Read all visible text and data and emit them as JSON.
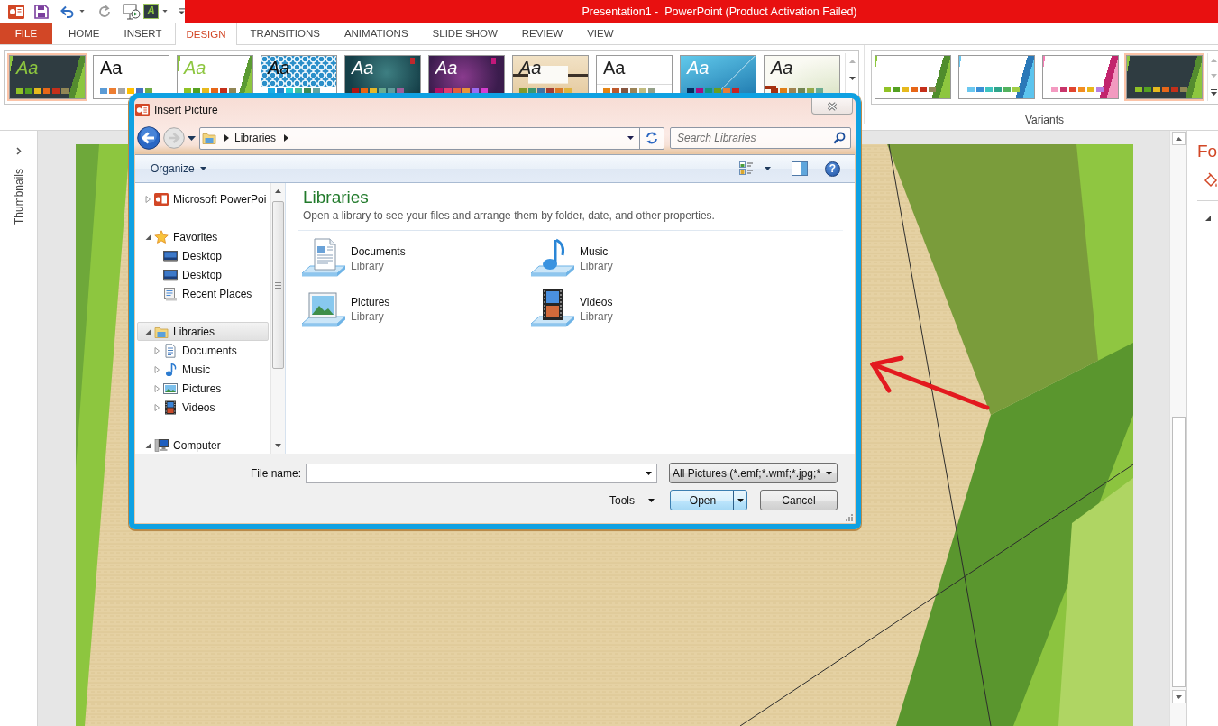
{
  "quick_access": {
    "theme_letter": "A"
  },
  "window": {
    "title": "Presentation1 -  PowerPoint (Product Activation Failed)"
  },
  "tabs": [
    {
      "label": "FILE",
      "kind": "file",
      "selected": false
    },
    {
      "label": "HOME",
      "kind": "tab",
      "selected": false
    },
    {
      "label": "INSERT",
      "kind": "tab",
      "selected": false
    },
    {
      "label": "DESIGN",
      "kind": "tab",
      "selected": true
    },
    {
      "label": "TRANSITIONS",
      "kind": "tab",
      "selected": false
    },
    {
      "label": "ANIMATIONS",
      "kind": "tab",
      "selected": false
    },
    {
      "label": "SLIDE SHOW",
      "kind": "tab",
      "selected": false
    },
    {
      "label": "REVIEW",
      "kind": "tab",
      "selected": false
    },
    {
      "label": "VIEW",
      "kind": "tab",
      "selected": false
    }
  ],
  "themes": [
    {
      "kind": "facet-dark",
      "sample": "Aa",
      "selected": true,
      "swatches": [
        {
          "color": "#90c226"
        },
        {
          "color": "#54a021"
        },
        {
          "color": "#e6b91e"
        },
        {
          "color": "#e76618"
        },
        {
          "color": "#c42f1a"
        },
        {
          "color": "#918655"
        }
      ]
    },
    {
      "kind": "office",
      "sample": "Aa",
      "selected": false,
      "swatches": [
        {
          "color": "#5b9bd5"
        },
        {
          "color": "#ed7d31"
        },
        {
          "color": "#a5a5a5"
        },
        {
          "color": "#ffc000"
        },
        {
          "color": "#4472c4"
        },
        {
          "color": "#70ad47"
        }
      ]
    },
    {
      "kind": "facet",
      "sample": "Aa",
      "selected": false,
      "swatches": [
        {
          "color": "#90c226"
        },
        {
          "color": "#54a021"
        },
        {
          "color": "#e6b91e"
        },
        {
          "color": "#e76618"
        },
        {
          "color": "#c42f1a"
        },
        {
          "color": "#918655"
        }
      ]
    },
    {
      "kind": "pattern",
      "sample": "Aa",
      "selected": false,
      "swatches": [
        {
          "color": "#1cade4"
        },
        {
          "color": "#2683c6"
        },
        {
          "color": "#27ced7"
        },
        {
          "color": "#42ba97"
        },
        {
          "color": "#3e8853"
        },
        {
          "color": "#62a39f"
        }
      ]
    },
    {
      "kind": "ion",
      "sample": "Aa",
      "selected": false,
      "swatches": [
        {
          "color": "#b01513"
        },
        {
          "color": "#ea6312"
        },
        {
          "color": "#e6b729"
        },
        {
          "color": "#6aac90"
        },
        {
          "color": "#5f9c9d"
        },
        {
          "color": "#9e5e9b"
        }
      ]
    },
    {
      "kind": "ion-boardroom",
      "sample": "Aa",
      "selected": false,
      "swatches": [
        {
          "color": "#b31166"
        },
        {
          "color": "#e33d6f"
        },
        {
          "color": "#e45f3c"
        },
        {
          "color": "#e9943a"
        },
        {
          "color": "#9b6bf2"
        },
        {
          "color": "#d53dd0"
        }
      ]
    },
    {
      "kind": "organic",
      "sample": "Aa",
      "selected": false,
      "swatches": [
        {
          "color": "#83992a"
        },
        {
          "color": "#3c9770"
        },
        {
          "color": "#44709d"
        },
        {
          "color": "#a23c33"
        },
        {
          "color": "#d97828"
        },
        {
          "color": "#deb340"
        }
      ]
    },
    {
      "kind": "retrospect",
      "sample": "Aa",
      "selected": false,
      "swatches": [
        {
          "color": "#e48312"
        },
        {
          "color": "#bd582c"
        },
        {
          "color": "#865640"
        },
        {
          "color": "#9b8357"
        },
        {
          "color": "#c2bc80"
        },
        {
          "color": "#94a088"
        }
      ]
    },
    {
      "kind": "slice",
      "sample": "Aa",
      "selected": false,
      "swatches": [
        {
          "color": "#052f61"
        },
        {
          "color": "#a50e82"
        },
        {
          "color": "#14967c"
        },
        {
          "color": "#6a9e1f"
        },
        {
          "color": "#e87d37"
        },
        {
          "color": "#c62324"
        }
      ]
    },
    {
      "kind": "wisp",
      "sample": "Aa",
      "selected": false,
      "swatches": [
        {
          "color": "#a53010"
        },
        {
          "color": "#de7e18"
        },
        {
          "color": "#9f8351"
        },
        {
          "color": "#728653"
        },
        {
          "color": "#92aa4c"
        },
        {
          "color": "#6aac91"
        }
      ]
    }
  ],
  "variants": {
    "label": "Variants",
    "items": [
      {
        "kind": "variant-green",
        "selected": false,
        "swatches": [
          {
            "color": "#90c226"
          },
          {
            "color": "#54a021"
          },
          {
            "color": "#e6b91e"
          },
          {
            "color": "#e76618"
          },
          {
            "color": "#c42f1a"
          },
          {
            "color": "#918655"
          }
        ]
      },
      {
        "kind": "variant-blue",
        "selected": false,
        "swatches": [
          {
            "color": "#6ac7f0"
          },
          {
            "color": "#3a8fd6"
          },
          {
            "color": "#3ec4c0"
          },
          {
            "color": "#2fa58b"
          },
          {
            "color": "#52b25d"
          },
          {
            "color": "#9fcd45"
          }
        ]
      },
      {
        "kind": "variant-pink",
        "selected": false,
        "swatches": [
          {
            "color": "#f49ac1"
          },
          {
            "color": "#c8356a"
          },
          {
            "color": "#e1452f"
          },
          {
            "color": "#f28e21"
          },
          {
            "color": "#e8b71a"
          },
          {
            "color": "#b77fe0"
          }
        ]
      },
      {
        "kind": "variant-dark",
        "selected": true,
        "swatches": [
          {
            "color": "#90c226"
          },
          {
            "color": "#54a021"
          },
          {
            "color": "#e6b91e"
          },
          {
            "color": "#e76618"
          },
          {
            "color": "#c42f1a"
          },
          {
            "color": "#918655"
          }
        ]
      }
    ]
  },
  "thumbnails_pane": {
    "label": "Thumbnails"
  },
  "format_pane": {
    "title": "Fo"
  },
  "dialog": {
    "title": "Insert Picture",
    "address": {
      "back": {
        "disabled": false
      },
      "forward": {
        "disabled": true
      },
      "crumbs": [
        "Libraries"
      ]
    },
    "search": {
      "placeholder": "Search Libraries"
    },
    "toolbar": {
      "organize": "Organize",
      "help": "?"
    },
    "nav": [
      {
        "label": "Microsoft PowerPoi",
        "kind": "app",
        "expanded": false,
        "selected": false
      },
      {
        "label": "Favorites",
        "kind": "favorites",
        "expanded": true,
        "selected": false,
        "children": [
          {
            "label": "Desktop",
            "kind": "desktop",
            "selected": false
          },
          {
            "label": "Desktop",
            "kind": "desktop",
            "selected": false
          },
          {
            "label": "Recent Places",
            "kind": "recent",
            "selected": false
          }
        ]
      },
      {
        "label": "Libraries",
        "kind": "libraries",
        "expanded": true,
        "selected": true,
        "children": [
          {
            "label": "Documents",
            "kind": "documents",
            "expanded": false,
            "selected": false
          },
          {
            "label": "Music",
            "kind": "music",
            "expanded": false,
            "selected": false
          },
          {
            "label": "Pictures",
            "kind": "pictures",
            "expanded": false,
            "selected": false
          },
          {
            "label": "Videos",
            "kind": "videos",
            "expanded": false,
            "selected": false
          }
        ]
      },
      {
        "label": "Computer",
        "kind": "computer",
        "expanded": true,
        "selected": false
      }
    ],
    "content": {
      "heading": "Libraries",
      "description": "Open a library to see your files and arrange them by folder, date, and other properties.",
      "items": [
        {
          "name": "Documents",
          "type": "Library",
          "kind": "documents"
        },
        {
          "name": "Music",
          "type": "Library",
          "kind": "music"
        },
        {
          "name": "Pictures",
          "type": "Library",
          "kind": "pictures"
        },
        {
          "name": "Videos",
          "type": "Library",
          "kind": "videos"
        }
      ]
    },
    "footer": {
      "file_name_label": "File name:",
      "file_type": "All Pictures (*.emf;*.wmf;*.jpg;*",
      "tools": "Tools",
      "open": "Open",
      "cancel": "Cancel"
    }
  }
}
